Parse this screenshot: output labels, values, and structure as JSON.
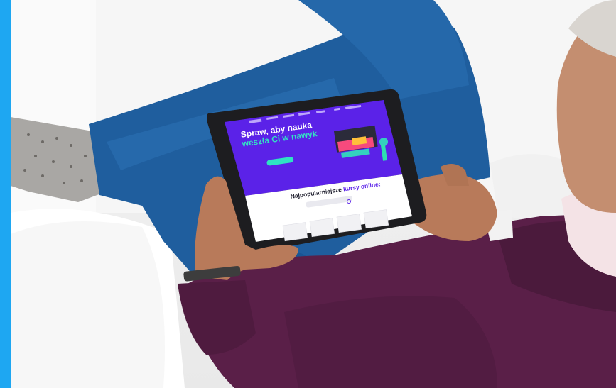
{
  "colors": {
    "accent_bar": "#1EA7F2",
    "screen_hero": "#5B22E8",
    "sweater": "#5A1F48",
    "jeans": "#1F5E9E",
    "skin": "#B87A5A"
  },
  "tablet": {
    "hero_line1": "Spraw, aby nauka",
    "hero_line2": "weszła Ci w nawyk",
    "section_title_part1": "Najpopularniejsze ",
    "section_title_part2": "kursy online:"
  },
  "icons": [
    "search-icon"
  ]
}
